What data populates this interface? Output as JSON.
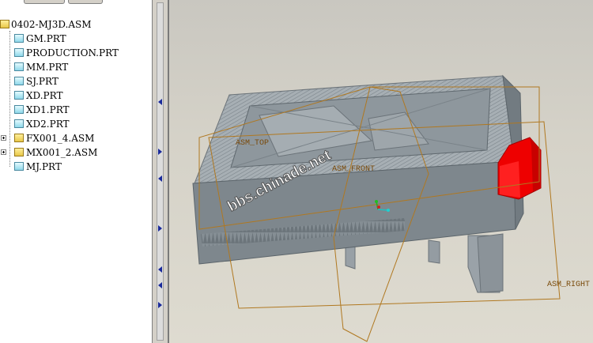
{
  "model_tree": {
    "root": {
      "label": "0402-MJ3D.ASM",
      "icon": "assembly-icon"
    },
    "items": [
      {
        "label": "GM.PRT",
        "icon": "part-icon",
        "expandable": false
      },
      {
        "label": "PRODUCTION.PRT",
        "icon": "part-icon",
        "expandable": false
      },
      {
        "label": "MM.PRT",
        "icon": "part-icon",
        "expandable": false
      },
      {
        "label": "SJ.PRT",
        "icon": "part-icon",
        "expandable": false
      },
      {
        "label": "XD.PRT",
        "icon": "part-icon",
        "expandable": false
      },
      {
        "label": "XD1.PRT",
        "icon": "part-icon",
        "expandable": false
      },
      {
        "label": "XD2.PRT",
        "icon": "part-icon",
        "expandable": false
      },
      {
        "label": "FX001_4.ASM",
        "icon": "assembly-icon",
        "expandable": true
      },
      {
        "label": "MX001_2.ASM",
        "icon": "assembly-icon",
        "expandable": true
      },
      {
        "label": "MJ.PRT",
        "icon": "part-icon",
        "expandable": false
      }
    ]
  },
  "viewport": {
    "datum_planes": {
      "top": "ASM_TOP",
      "front": "ASM_FRONT",
      "right": "ASM_RIGHT"
    },
    "watermark": "bbs.chinade.net",
    "colors": {
      "background": "#d5d2c8",
      "model": "#8e979d",
      "highlight": "#ff0000",
      "datum_plane": "#b07820"
    }
  }
}
